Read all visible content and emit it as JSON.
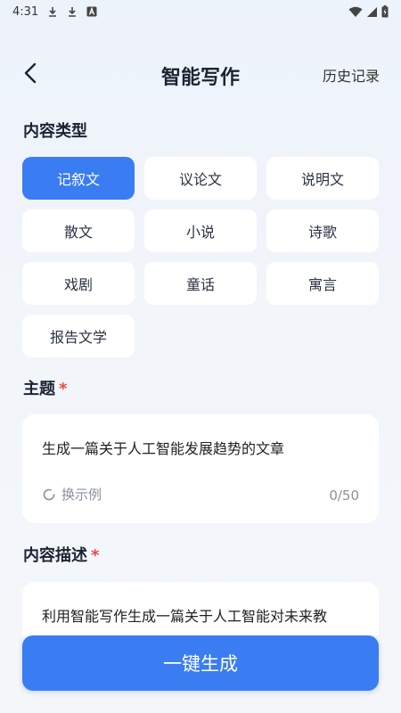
{
  "status_bar": {
    "time": "4:31"
  },
  "header": {
    "title": "智能写作",
    "history_label": "历史记录"
  },
  "content_type": {
    "label": "内容类型",
    "options": [
      "记叙文",
      "议论文",
      "说明文",
      "散文",
      "小说",
      "诗歌",
      "戏剧",
      "童话",
      "寓言",
      "报告文学"
    ],
    "selected": "记叙文"
  },
  "topic": {
    "label": "主题",
    "required_mark": "*",
    "value": "生成一篇关于人工智能发展趋势的文章",
    "swap_label": "换示例",
    "count": "0/50"
  },
  "description": {
    "label": "内容描述",
    "required_mark": "*",
    "value": "利用智能写作生成一篇关于人工智能对未来教"
  },
  "generate_label": "一键生成",
  "colors": {
    "accent": "#3a7cf2",
    "required": "#e8474a"
  }
}
